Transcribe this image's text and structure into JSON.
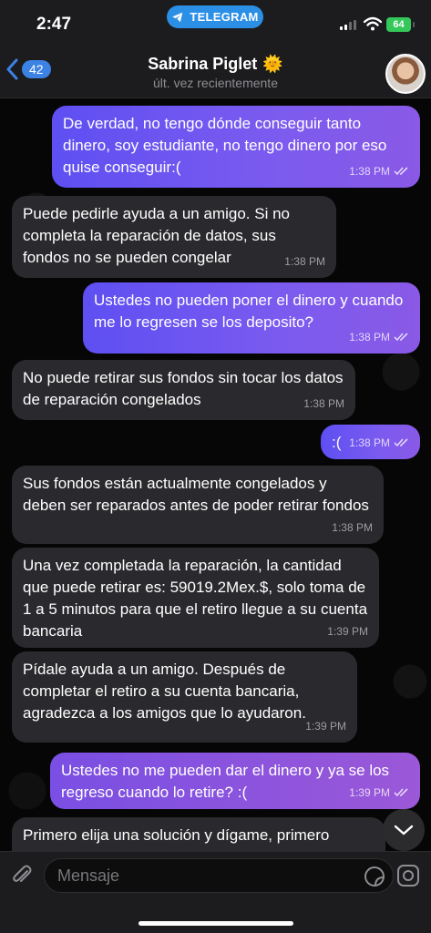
{
  "status": {
    "time": "2:47",
    "app_pill": "TELEGRAM",
    "battery": "64"
  },
  "header": {
    "back_count": "42",
    "title": "Sabrina Piglet",
    "title_emoji": "🌞",
    "subtitle": "últ. vez recientemente"
  },
  "messages": [
    {
      "dir": "out",
      "text": "De verdad, no tengo dónde conseguir tanto dinero, soy estudiante, no tengo dinero por eso quise conseguir:(",
      "time": "1:38 PM"
    },
    {
      "dir": "in",
      "text": "Puede pedirle ayuda a un amigo. Si no completa la reparación de datos, sus fondos no se pueden congelar",
      "time": "1:38 PM"
    },
    {
      "dir": "out",
      "text": "Ustedes no pueden poner el dinero y cuando me lo regresen se los deposito?",
      "time": "1:38 PM"
    },
    {
      "dir": "in",
      "text": "No puede retirar sus fondos sin tocar los datos de reparación congelados",
      "time": "1:38 PM"
    },
    {
      "dir": "out",
      "text": ":(",
      "time": "1:38 PM"
    },
    {
      "dir": "in",
      "text": "Sus fondos están actualmente congelados y deben ser reparados antes de poder retirar fondos",
      "time": "1:38 PM"
    },
    {
      "dir": "in",
      "text": "Una vez completada la reparación, la cantidad que puede retirar es: 59019.2Mex.$, solo toma de 1 a 5 minutos para que el retiro llegue a su cuenta bancaria",
      "time": "1:39 PM"
    },
    {
      "dir": "in",
      "text": "Pídale ayuda a un amigo. Después de completar el retiro a su cuenta bancaria, agradezca a los amigos que lo ayudaron.",
      "time": "1:39 PM"
    },
    {
      "dir": "out",
      "text": "Ustedes no me pueden dar el dinero y ya se los regreso cuando lo retire? :(",
      "time": "1:39 PM"
    },
    {
      "dir": "in",
      "text": "Primero elija una solución y dígame, primero",
      "time": ""
    }
  ],
  "input": {
    "placeholder": "Mensaje"
  },
  "colors": {
    "outgoing": "#6a55ef",
    "incoming": "#2a2a2e",
    "accent": "#3b82e3",
    "battery": "#34c759"
  },
  "icons": [
    "telegram-icon",
    "signal-icon",
    "wifi-icon",
    "back-chevron-icon",
    "attach-icon",
    "sticker-icon",
    "camera-icon",
    "chevron-down-icon",
    "read-check-icon"
  ]
}
